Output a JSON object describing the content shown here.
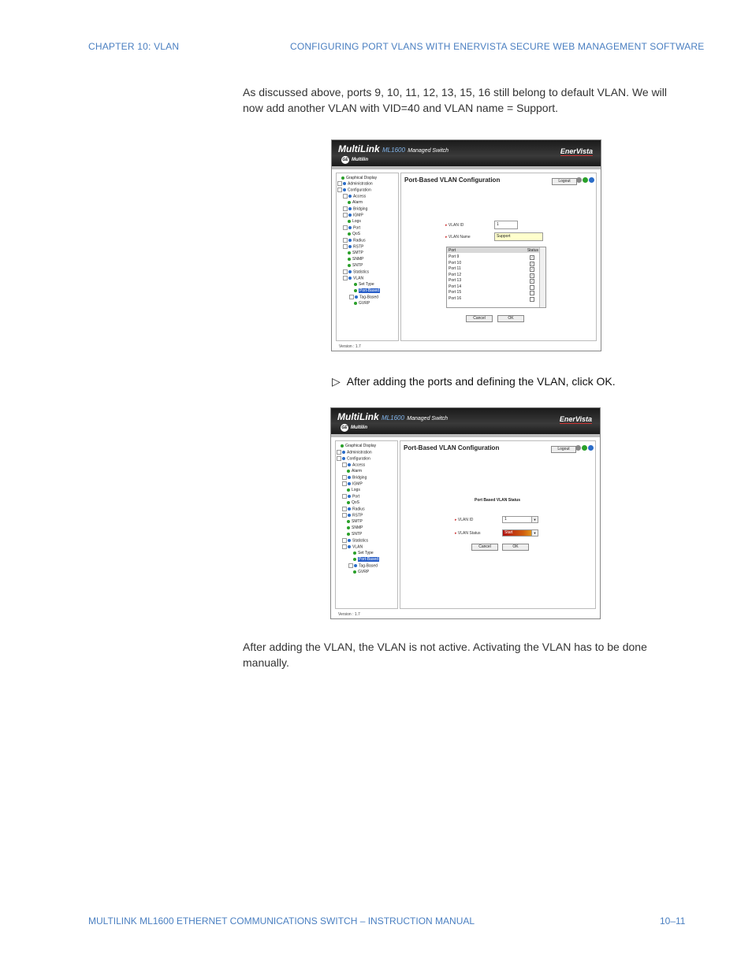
{
  "header": {
    "left": "CHAPTER 10: VLAN",
    "right": "CONFIGURING PORT VLANS WITH ENERVISTA SECURE WEB MANAGEMENT SOFTWARE"
  },
  "intro_para": "As discussed above, ports 9, 10, 11, 12, 13, 15, 16 still belong to default VLAN. We will now add another VLAN with VID=40 and VLAN name = Support.",
  "step_text": "After adding the ports and defining the VLAN, click OK.",
  "closing_para": "After adding the VLAN, the VLAN is not active. Activating the VLAN has to be done manually.",
  "footer": {
    "left": "MULTILINK ML1600 ETHERNET COMMUNICATIONS SWITCH – INSTRUCTION MANUAL",
    "right": "10–11"
  },
  "app": {
    "logo": "MultiLink",
    "model": "ML1600",
    "product": "Managed Switch",
    "ge_label": "GE",
    "company": "Multilin",
    "brand": "EnerVista",
    "page_title": "Port-Based VLAN Configuration",
    "logout": "Logout",
    "version": "Version : 1.7"
  },
  "tree": {
    "graphical_display": "Graphical Display",
    "administration": "Administration",
    "configuration": "Configuration",
    "access": "Access",
    "alarm": "Alarm",
    "bridging": "Bridging",
    "igmp": "IGMP",
    "logs": "Logs",
    "port": "Port",
    "qos": "QoS",
    "radius": "Radius",
    "rstp": "RSTP",
    "smtp": "SMTP",
    "snmp": "SNMP",
    "sntp": "SNTP",
    "statistics": "Statistics",
    "vlan": "VLAN",
    "set_type": "Set Type",
    "port_based": "Port-Based",
    "tag_based": "Tag-Based",
    "gvrp": "GVRP"
  },
  "shot1": {
    "vlan_id_label": "VLAN ID",
    "vlan_id_value": "1",
    "vlan_name_label": "VLAN Name",
    "vlan_name_value": "Support",
    "col_port": "Port",
    "col_status": "Status",
    "ports": [
      {
        "name": "Port 9",
        "checked": true
      },
      {
        "name": "Port 10",
        "checked": true
      },
      {
        "name": "Port 11",
        "checked": true
      },
      {
        "name": "Port 12",
        "checked": true
      },
      {
        "name": "Port 13",
        "checked": true
      },
      {
        "name": "Port 14",
        "checked": false
      },
      {
        "name": "Port 15",
        "checked": false
      },
      {
        "name": "Port 16",
        "checked": false
      }
    ],
    "cancel": "Cancel",
    "ok": "OK"
  },
  "shot2": {
    "status_title": "Port Based VLAN Status",
    "vlan_id_label": "VLAN ID",
    "vlan_id_value": "1",
    "vlan_status_label": "VLAN Status",
    "vlan_status_value": "Start",
    "cancel": "Cancel",
    "ok": "OK"
  }
}
